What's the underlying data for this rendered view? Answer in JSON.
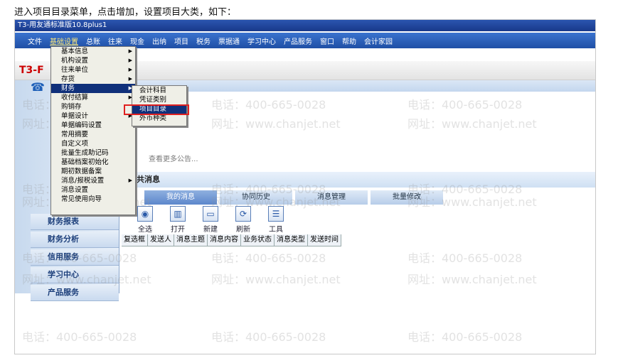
{
  "instruction": "进入项目目录菜单，点击增加，设置项目大类，如下：",
  "window": {
    "title": "T3-用友通标准版10.8plus1"
  },
  "menubar": [
    "文件",
    "基础设置",
    "总账",
    "往来",
    "现金",
    "出纳",
    "项目",
    "税务",
    "票据通",
    "学习中心",
    "产品服务",
    "窗口",
    "帮助",
    "会计家园"
  ],
  "logo": {
    "brand": "T3-F"
  },
  "main_menu": {
    "items": [
      {
        "label": "基本信息",
        "arrow": true
      },
      {
        "label": "机构设置",
        "arrow": true
      },
      {
        "label": "往来单位",
        "arrow": true
      },
      {
        "label": "存货",
        "arrow": true
      },
      {
        "label": "财务",
        "arrow": true
      },
      {
        "label": "收付结算",
        "arrow": true
      },
      {
        "label": "购销存",
        "arrow": false
      },
      {
        "label": "单据设计",
        "arrow": true
      },
      {
        "label": "单据编码设置",
        "arrow": false
      },
      {
        "label": "常用摘要",
        "arrow": false
      },
      {
        "label": "自定义项",
        "arrow": false
      },
      {
        "label": "批量生成助记码",
        "arrow": false
      },
      {
        "label": "基础档案初始化",
        "arrow": false
      },
      {
        "label": "期初数据备案",
        "arrow": false
      },
      {
        "label": "消息/报税设置",
        "arrow": true
      },
      {
        "label": "消息设置",
        "arrow": false
      },
      {
        "label": "常见使用向导",
        "arrow": false
      }
    ],
    "highlighted_index": 4
  },
  "sub_menu": {
    "items": [
      "会计科目",
      "凭证类别",
      "项目目录",
      "外币种类"
    ],
    "highlighted_index": 2
  },
  "left_nav": {
    "items": [
      "财务报表",
      "财务分析",
      "信用服务",
      "学习中心",
      "产品服务"
    ]
  },
  "content": {
    "more_notices": "查看更多公告...",
    "public_title": "公共消息",
    "tabs": [
      "我的消息",
      "协同历史",
      "消息管理",
      "批量修改"
    ],
    "selected_tab": 0,
    "toolbar": [
      {
        "label": "全选",
        "icon": "select-all-icon"
      },
      {
        "label": "打开",
        "icon": "open-icon"
      },
      {
        "label": "新建",
        "icon": "new-icon"
      },
      {
        "label": "刷新",
        "icon": "refresh-icon"
      },
      {
        "label": "工具",
        "icon": "tools-icon"
      }
    ],
    "columns": [
      "复选框",
      "发送人",
      "消息主题",
      "消息内容",
      "业务状态",
      "消息类型",
      "发送时间"
    ]
  },
  "watermark": {
    "phone": "电话：400-665-0028",
    "site": "网址：www.chanjet.net"
  },
  "colors": {
    "menubar": "#1f4fa5",
    "highlight": "#10307a",
    "callout": "#e02020"
  }
}
